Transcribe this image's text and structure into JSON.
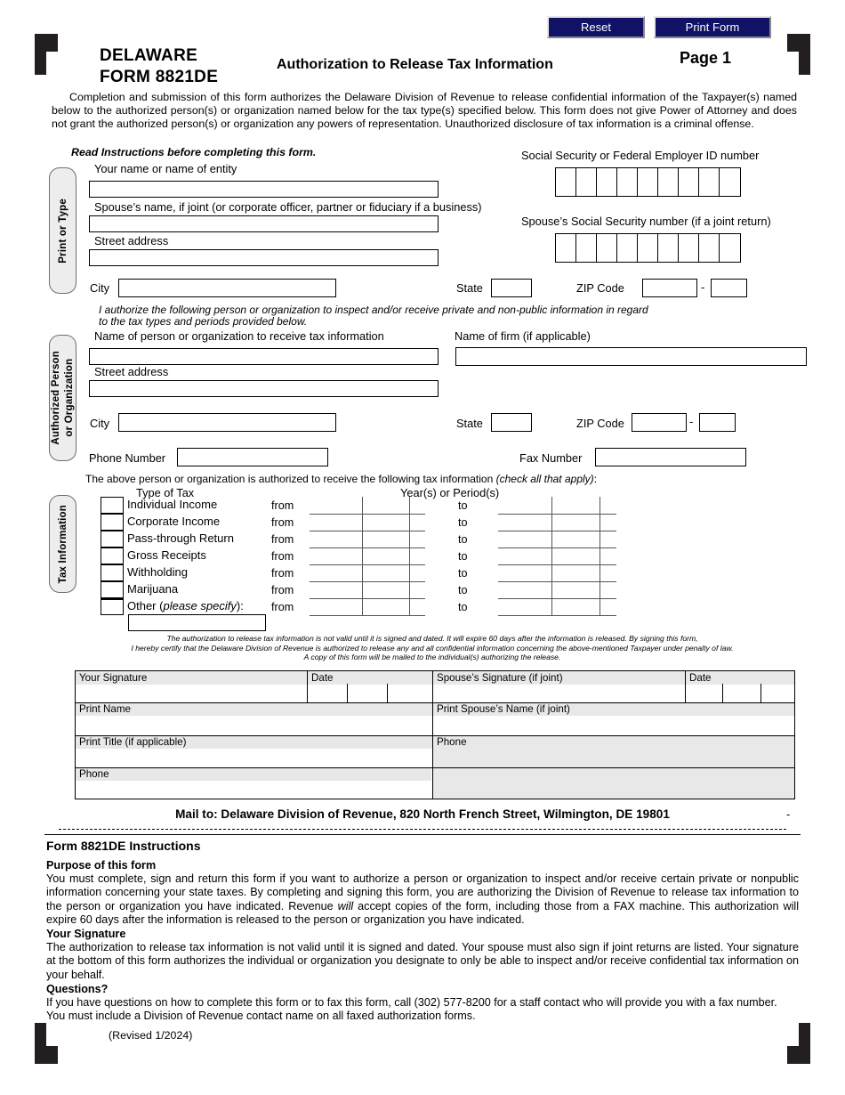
{
  "toolbar": {
    "reset_label": "Reset",
    "print_label": "Print Form"
  },
  "header": {
    "state": "DELAWARE",
    "form_number": "FORM 8821DE",
    "title": "Authorization to Release Tax Information",
    "page": "Page 1",
    "intro": "Completion and submission of this form authorizes the Delaware Division of Revenue to release confidential information of the Taxpayer(s) named below to the authorized person(s) or  organization named below for the tax type(s) specified below.  This form does not give Power of Attorney and does not grant the authorized person(s) or organization any powers of representation.  Unauthorized disclosure of tax information is a criminal offense.",
    "read_instructions": "Read Instructions before completing this form."
  },
  "section_tabs": {
    "print_or_type": "Print or Type",
    "authorized_person_line1": "Authorized Person",
    "authorized_person_line2": "or Organization",
    "tax_information": "Tax Information"
  },
  "taxpayer": {
    "name_label": "Your name or name of entity",
    "spouse_name_label": "Spouse’s name, if joint (or corporate officer, partner or fiduciary if a business)",
    "street_label": "Street address",
    "city_label": "City",
    "state_label": "State",
    "zip_label": "ZIP Code",
    "zip_dash": "-",
    "ssn_label": "Social Security or Federal Employer ID number",
    "spouse_ssn_label": "Spouse’s Social Security number (if a joint return)",
    "ssn_cells": 9,
    "name_value": "",
    "spouse_name_value": "",
    "street_value": "",
    "city_value": "",
    "state_value": "",
    "zip_value": "",
    "zip4_value": ""
  },
  "authorized": {
    "authorize_line1": "I authorize the following person or organization to inspect and/or receive private and non-public information in regard",
    "authorize_line2": "to the tax types and periods provided below.",
    "name_label": "Name of person or organization to receive tax information",
    "firm_label": "Name of firm (if applicable)",
    "street_label": "Street address",
    "city_label": "City",
    "state_label": "State",
    "zip_label": "ZIP Code",
    "zip_dash": "-",
    "phone_label": "Phone Number",
    "fax_label": "Fax Number",
    "name_value": "",
    "firm_value": "",
    "street_value": "",
    "city_value": "",
    "state_value": "",
    "zip_value": "",
    "zip4_value": "",
    "phone_value": "",
    "fax_value": ""
  },
  "tax_info": {
    "intro_plain": "The above person or organization is authorized to receive the following tax information ",
    "intro_italic": "(check all that apply)",
    "intro_end": ":",
    "col_type": "Type of Tax",
    "col_years": "Year(s)  or  Period(s)",
    "from_label": "from",
    "to_label": "to",
    "other_prefix": "Other (",
    "other_italic": "please specify",
    "other_suffix": "):",
    "other_value": "",
    "rows": [
      {
        "label": "Individual Income",
        "checked": false,
        "from": "",
        "to": ""
      },
      {
        "label": "Corporate Income",
        "checked": false,
        "from": "",
        "to": ""
      },
      {
        "label": "Pass-through Return",
        "checked": false,
        "from": "",
        "to": ""
      },
      {
        "label": "Gross Receipts",
        "checked": false,
        "from": "",
        "to": ""
      },
      {
        "label": "Withholding",
        "checked": false,
        "from": "",
        "to": ""
      },
      {
        "label": "Marijuana",
        "checked": false,
        "from": "",
        "to": ""
      },
      {
        "label": "",
        "checked": false,
        "from": "",
        "to": ""
      }
    ]
  },
  "certification": {
    "line1": "The authorization to release tax information is not valid until it is signed and dated. It will expire 60 days after the information is released. By signing this form,",
    "line2": "I hereby certify that the Delaware Division of Revenue  is  authorized  to release any and all confidential information concerning the above-mentioned Taxpayer under penalty of law.",
    "line3": "A copy of this form will be mailed to the individual(s) authorizing the release."
  },
  "signature_block": {
    "your_signature": "Your Signature",
    "date": "Date",
    "spouse_signature": "Spouse’s Signature (if joint)",
    "spouse_date": "Date",
    "print_name": "Print Name",
    "print_spouse_name": "Print Spouse’s Name (if joint)",
    "print_title": "Print Title (if applicable)",
    "phone_right": "Phone",
    "phone_left": "Phone",
    "your_signature_value": "",
    "date_value": "",
    "spouse_signature_value": "",
    "spouse_date_value": "",
    "print_name_value": "",
    "print_spouse_name_value": "",
    "print_title_value": "",
    "phone_right_value": "",
    "phone_left_value": ""
  },
  "mail_to": "Mail to:  Delaware Division of Revenue, 820 North French Street, Wilmington, DE 19801",
  "mail_tick": "-",
  "instructions": {
    "heading": "Form 8821DE Instructions",
    "purpose_heading": "Purpose of this form",
    "purpose_text_a": "You must complete, sign and return this form if you want to authorize a person or organization to inspect and/or receive certain private or nonpublic information concerning your state taxes. By completing and signing this form, you are authorizing the Division of Revenue to release tax information to the person or organization you have indicated. Revenue ",
    "purpose_text_italic": "will",
    "purpose_text_b": " accept copies of the form, including those from a FAX machine. This authorization will expire 60 days after the information is released to the person or organization you have indicated.",
    "signature_heading": "Your Signature",
    "signature_text": "The authorization to release tax information is not valid until it is signed and dated. Your spouse must also sign if joint returns are listed. Your signature at the bottom of this form authorizes the individual or organization you designate to only be able to inspect and/or receive confidential tax information on your behalf.",
    "questions_heading": "Questions?",
    "questions_text": "If you have questions on how to complete this form or to fax this form, call (302) 577-8200 for a staff contact who will provide you with a fax number. You must include a Division of Revenue contact name on all faxed authorization forms."
  },
  "revised": "(Revised 1/2024)",
  "colors": {
    "button_bg": "#111166",
    "button_text": "#ffffff",
    "tab_bg": "#ededed",
    "band_bg": "#e8e8e8"
  }
}
